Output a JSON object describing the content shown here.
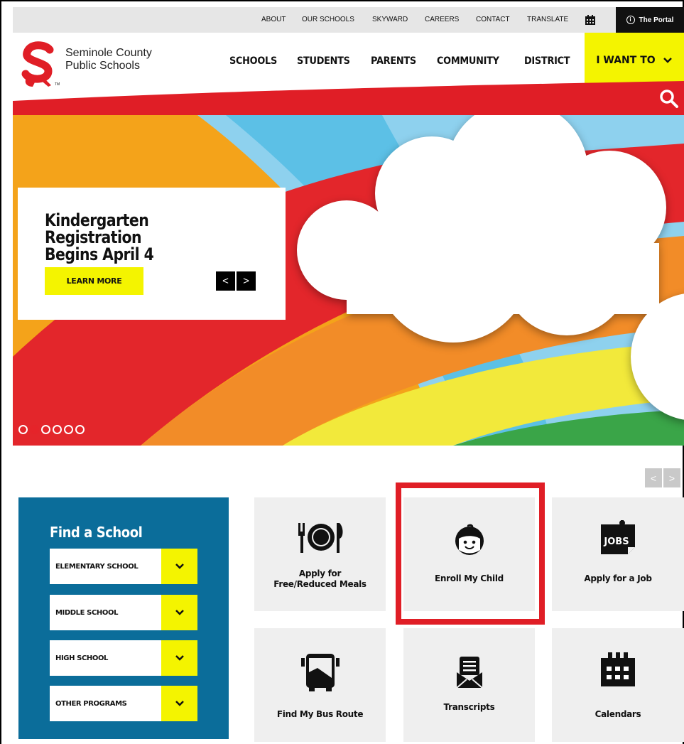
{
  "utility_nav": {
    "links": [
      "ABOUT",
      "OUR SCHOOLS",
      "SKYWARD",
      "CAREERS",
      "CONTACT",
      "TRANSLATE"
    ],
    "portal_label": "The Portal"
  },
  "header": {
    "brand_line1": "Seminole County",
    "brand_line2": "Public Schools",
    "trademark": "TM",
    "nav": [
      "SCHOOLS",
      "STUDENTS",
      "PARENTS",
      "COMMUNITY",
      "DISTRICT"
    ],
    "i_want_to": "I WANT TO"
  },
  "hero": {
    "headline_line1": "Kindergarten Registration",
    "headline_line2": "Begins April 4",
    "cta_label": "LEARN MORE",
    "prev": "<",
    "next": ">",
    "slide_count": 6,
    "active_slide": 2
  },
  "quick_links_nav": {
    "prev": "<",
    "next": ">"
  },
  "find_school": {
    "title": "Find a School",
    "options": [
      "ELEMENTARY SCHOOL",
      "MIDDLE SCHOOL",
      "HIGH SCHOOL",
      "OTHER PROGRAMS"
    ]
  },
  "tiles": [
    {
      "label_line1": "Apply for",
      "label_line2": "Free/Reduced Meals",
      "icon": "meal-icon"
    },
    {
      "label_line1": "Enroll My Child",
      "label_line2": "",
      "icon": "child-face-icon",
      "highlighted": true
    },
    {
      "label_line1": "Apply for a Job",
      "label_line2": "",
      "icon": "jobs-icon",
      "icon_text": "JOBS"
    },
    {
      "label_line1": "Find My Bus Route",
      "label_line2": "",
      "icon": "bus-icon"
    },
    {
      "label_line1": "Transcripts",
      "label_line2": "",
      "icon": "envelope-document-icon"
    },
    {
      "label_line1": "Calendars",
      "label_line2": "",
      "icon": "calendar-icon"
    }
  ],
  "colors": {
    "accent_yellow": "#f4f400",
    "brand_red": "#e01e26",
    "finder_blue": "#0b6d9a",
    "tile_gray": "#efefef"
  }
}
